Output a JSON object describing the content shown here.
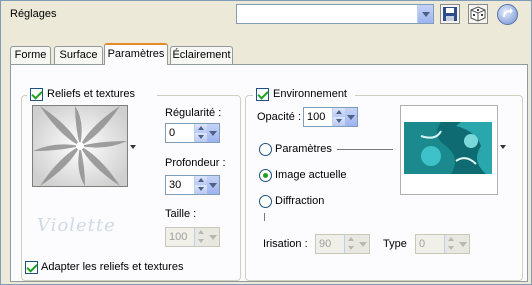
{
  "header": {
    "presets_label": "Réglages",
    "preset_value": ""
  },
  "tabs": [
    {
      "label": "Forme"
    },
    {
      "label": "Surface"
    },
    {
      "label": "Paramètres"
    },
    {
      "label": "Éclairement"
    }
  ],
  "reliefs": {
    "checkbox_label": "Reliefs et textures",
    "checked": true,
    "regularite_label": "Régularité :",
    "regularite_value": "0",
    "profondeur_label": "Profondeur :",
    "profondeur_value": "30",
    "taille_label": "Taille :",
    "taille_value": "100",
    "watermark": "Violette",
    "adapter_label": "Adapter les reliefs et textures",
    "adapter_checked": true
  },
  "environment": {
    "checkbox_label": "Environnement",
    "checked": true,
    "opacite_label": "Opacité :",
    "opacite_value": "100",
    "radio_parametres": "Paramètres",
    "radio_image": "Image actuelle",
    "radio_diffraction": "Diffraction",
    "selected": "Image actuelle",
    "irisation_label": "Irisation :",
    "irisation_value": "90",
    "type_label": "Type",
    "type_value": "0"
  },
  "colors": {
    "accent_tab": "#e68b2c",
    "check_green": "#21a121",
    "xp_blue": "#7f9db9"
  }
}
